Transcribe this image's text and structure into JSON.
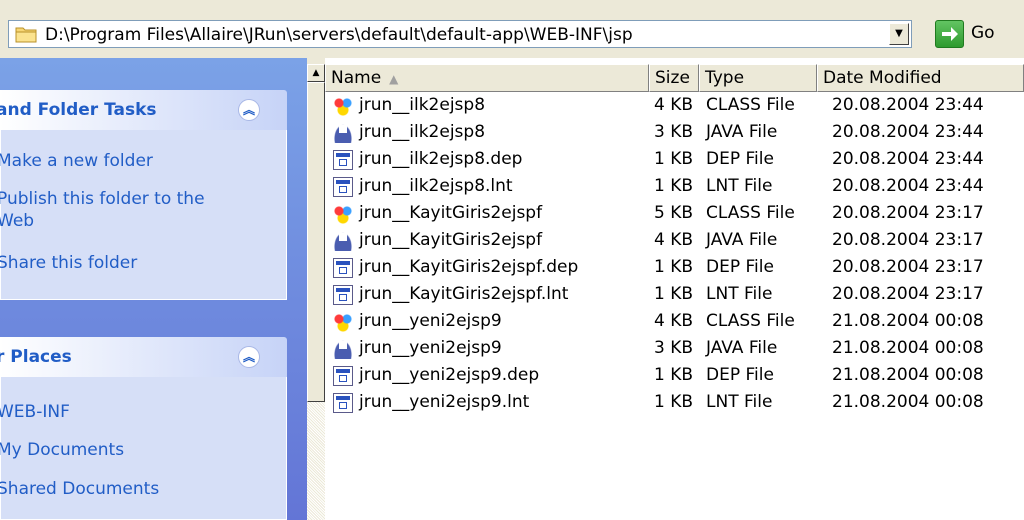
{
  "address_bar": {
    "path": "D:\\Program Files\\Allaire\\JRun\\servers\\default\\default-app\\WEB-INF\\jsp",
    "go_label": "Go",
    "icons": {
      "folder": "folder-icon",
      "dropdown": "chevron-down-icon",
      "go": "go-arrow-icon"
    }
  },
  "task_pane": {
    "file_folder_tasks": {
      "title": "and Folder Tasks",
      "items": [
        "Make a new folder",
        "Publish this folder to the\nWeb",
        "Share this folder"
      ]
    },
    "other_places": {
      "title": "r Places",
      "items": [
        "WEB-INF",
        "My Documents",
        "Shared Documents"
      ]
    }
  },
  "file_list": {
    "columns": {
      "name": "Name",
      "size": "Size",
      "type": "Type",
      "date": "Date Modified"
    },
    "rows": [
      {
        "icon": "class-file-icon",
        "name": "jrun__ilk2ejsp8",
        "size": "4 KB",
        "type": "CLASS File",
        "date": "20.08.2004 23:44"
      },
      {
        "icon": "java-file-icon",
        "name": "jrun__ilk2ejsp8",
        "size": "3 KB",
        "type": "JAVA File",
        "date": "20.08.2004 23:44"
      },
      {
        "icon": "generic-file-icon",
        "name": "jrun__ilk2ejsp8.dep",
        "size": "1 KB",
        "type": "DEP File",
        "date": "20.08.2004 23:44"
      },
      {
        "icon": "generic-file-icon",
        "name": "jrun__ilk2ejsp8.lnt",
        "size": "1 KB",
        "type": "LNT File",
        "date": "20.08.2004 23:44"
      },
      {
        "icon": "class-file-icon",
        "name": "jrun__KayitGiris2ejspf",
        "size": "5 KB",
        "type": "CLASS File",
        "date": "20.08.2004 23:17"
      },
      {
        "icon": "java-file-icon",
        "name": "jrun__KayitGiris2ejspf",
        "size": "4 KB",
        "type": "JAVA File",
        "date": "20.08.2004 23:17"
      },
      {
        "icon": "generic-file-icon",
        "name": "jrun__KayitGiris2ejspf.dep",
        "size": "1 KB",
        "type": "DEP File",
        "date": "20.08.2004 23:17"
      },
      {
        "icon": "generic-file-icon",
        "name": "jrun__KayitGiris2ejspf.lnt",
        "size": "1 KB",
        "type": "LNT File",
        "date": "20.08.2004 23:17"
      },
      {
        "icon": "class-file-icon",
        "name": "jrun__yeni2ejsp9",
        "size": "4 KB",
        "type": "CLASS File",
        "date": "21.08.2004 00:08"
      },
      {
        "icon": "java-file-icon",
        "name": "jrun__yeni2ejsp9",
        "size": "3 KB",
        "type": "JAVA File",
        "date": "21.08.2004 00:08"
      },
      {
        "icon": "generic-file-icon",
        "name": "jrun__yeni2ejsp9.dep",
        "size": "1 KB",
        "type": "DEP File",
        "date": "21.08.2004 00:08"
      },
      {
        "icon": "generic-file-icon",
        "name": "jrun__yeni2ejsp9.lnt",
        "size": "1 KB",
        "type": "LNT File",
        "date": "21.08.2004 00:08"
      }
    ]
  },
  "colors": {
    "task_link": "#215dc6",
    "pane_bg": "#d6dff7",
    "go_green": "#2e9a2e"
  }
}
